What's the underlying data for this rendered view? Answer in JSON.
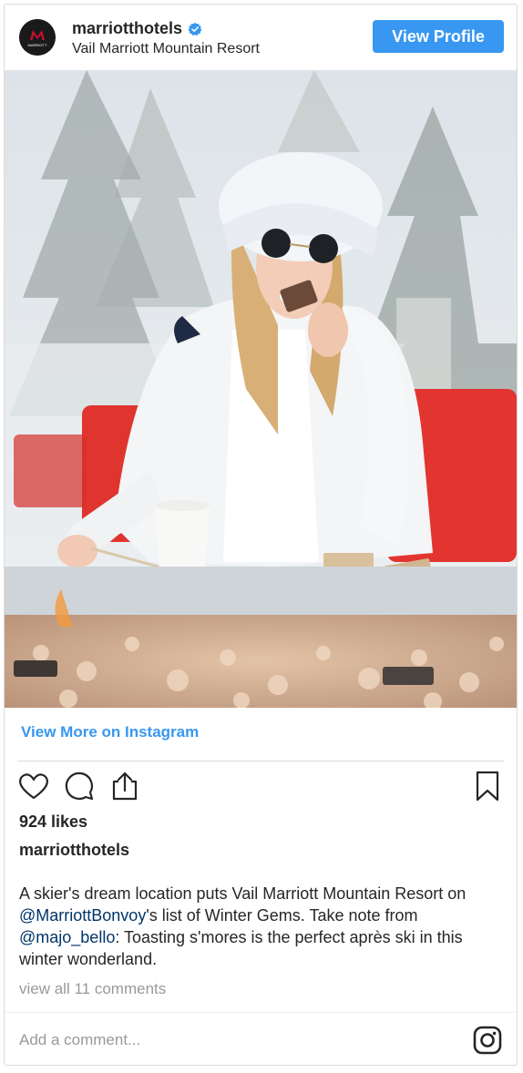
{
  "header": {
    "username": "marriotthotels",
    "location": "Vail Marriott Mountain Resort",
    "view_profile_label": "View Profile",
    "avatar_text": "MARRIOTT"
  },
  "post": {
    "view_more_label": "View More on Instagram",
    "likes": "924 likes",
    "caption_user": "marriotthotels",
    "caption_part1": "A skier's dream location puts Vail Marriott Mountain Resort on ",
    "caption_mention1": "@MarriottBonvoy",
    "caption_part2": "'s list of Winter Gems. Take note from ",
    "caption_mention2": "@majo_bello",
    "caption_part3": ": Toasting s'mores is the perfect après ski in this winter wonderland.",
    "comments_label": "view all 11 comments",
    "add_comment_placeholder": "Add a comment..."
  },
  "icons": {
    "like": "heart-icon",
    "comment": "comment-icon",
    "share": "share-icon",
    "save": "bookmark-icon",
    "instagram": "instagram-icon",
    "verified": "verified-badge-icon"
  },
  "colors": {
    "accent": "#3897f0",
    "mention": "#003569",
    "muted": "#999999",
    "text": "#262626"
  }
}
